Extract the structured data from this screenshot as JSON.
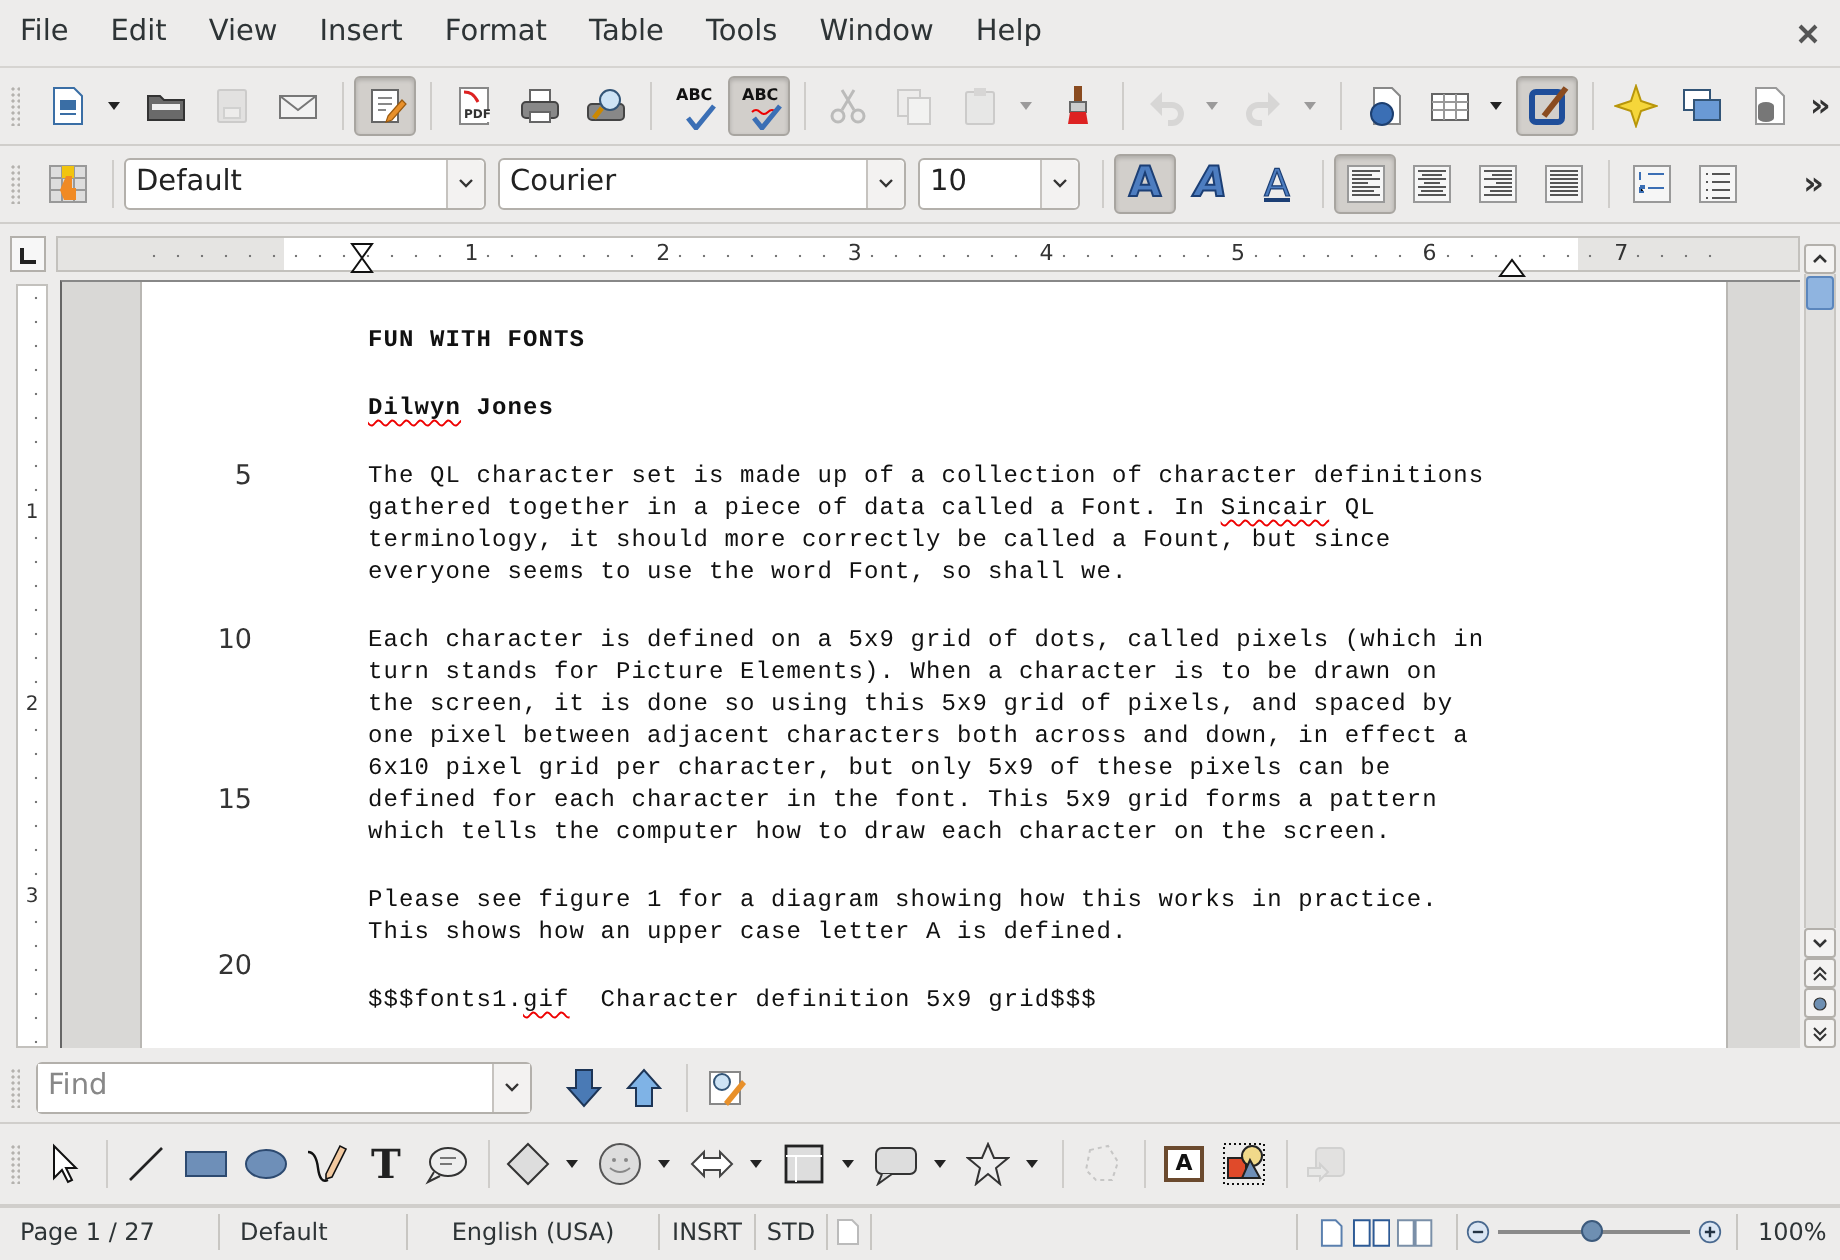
{
  "menu": [
    {
      "label": "File"
    },
    {
      "label": "Edit"
    },
    {
      "label": "View"
    },
    {
      "label": "Insert"
    },
    {
      "label": "Format"
    },
    {
      "label": "Table"
    },
    {
      "label": "Tools"
    },
    {
      "label": "Window"
    },
    {
      "label": "Help"
    }
  ],
  "standard_toolbar": {
    "items": [
      {
        "kind": "tool",
        "pressed": false,
        "disabled": false
      },
      {
        "kind": "dropdown",
        "disabled": false
      },
      {
        "kind": "tool",
        "pressed": false,
        "disabled": false
      },
      {
        "kind": "tool",
        "pressed": false,
        "disabled": true
      },
      {
        "kind": "tool",
        "pressed": false,
        "disabled": false
      },
      {
        "kind": "separator"
      },
      {
        "kind": "tool",
        "pressed": true,
        "disabled": false
      },
      {
        "kind": "separator"
      },
      {
        "kind": "tool",
        "pressed": false,
        "disabled": false,
        "glyph": "PDF"
      },
      {
        "kind": "tool",
        "pressed": false,
        "disabled": false
      },
      {
        "kind": "tool",
        "pressed": false,
        "disabled": false
      },
      {
        "kind": "separator"
      },
      {
        "kind": "tool",
        "pressed": false,
        "disabled": false,
        "glyph": "ABC"
      },
      {
        "kind": "tool",
        "pressed": true,
        "disabled": false,
        "glyph": "ABC"
      },
      {
        "kind": "separator"
      },
      {
        "kind": "tool",
        "pressed": false,
        "disabled": true
      },
      {
        "kind": "tool",
        "pressed": false,
        "disabled": true
      },
      {
        "kind": "tool",
        "pressed": false,
        "disabled": true
      },
      {
        "kind": "dropdown",
        "disabled": true
      },
      {
        "kind": "tool",
        "pressed": false,
        "disabled": false
      },
      {
        "kind": "separator"
      },
      {
        "kind": "tool",
        "pressed": false,
        "disabled": true
      },
      {
        "kind": "dropdown",
        "disabled": true
      },
      {
        "kind": "tool",
        "pressed": false,
        "disabled": true
      },
      {
        "kind": "dropdown",
        "disabled": true
      },
      {
        "kind": "separator"
      },
      {
        "kind": "tool",
        "pressed": false,
        "disabled": false
      },
      {
        "kind": "tool",
        "pressed": false,
        "disabled": false
      },
      {
        "kind": "dropdown",
        "disabled": false
      },
      {
        "kind": "tool",
        "pressed": true,
        "disabled": false
      },
      {
        "kind": "separator"
      },
      {
        "kind": "tool",
        "pressed": false,
        "disabled": false
      },
      {
        "kind": "tool",
        "pressed": false,
        "disabled": false
      },
      {
        "kind": "tool",
        "pressed": false,
        "disabled": false
      },
      {
        "kind": "overflow",
        "text": "»"
      }
    ]
  },
  "formatting_toolbar": {
    "items": [
      {
        "kind": "tool",
        "pressed": false,
        "disabled": false
      },
      {
        "kind": "separator"
      },
      {
        "kind": "combo",
        "value": "Default"
      },
      {
        "kind": "combo",
        "value": "Courier"
      },
      {
        "kind": "combo",
        "value": "10"
      },
      {
        "kind": "separator"
      },
      {
        "kind": "tool",
        "pressed": true,
        "disabled": false,
        "glyph": "A"
      },
      {
        "kind": "tool",
        "pressed": false,
        "disabled": false,
        "glyph": "A"
      },
      {
        "kind": "tool",
        "pressed": false,
        "disabled": false,
        "glyph": "A"
      },
      {
        "kind": "separator"
      },
      {
        "kind": "tool",
        "pressed": true,
        "disabled": false
      },
      {
        "kind": "tool",
        "pressed": false,
        "disabled": false
      },
      {
        "kind": "tool",
        "pressed": false,
        "disabled": false
      },
      {
        "kind": "tool",
        "pressed": false,
        "disabled": false
      },
      {
        "kind": "separator"
      },
      {
        "kind": "tool",
        "pressed": false,
        "disabled": false
      },
      {
        "kind": "tool",
        "pressed": false,
        "disabled": false
      },
      {
        "kind": "overflow",
        "text": "»"
      }
    ]
  },
  "ruler": {
    "labels": [
      "1",
      "2",
      "3",
      "4",
      "5",
      "6",
      "7"
    ]
  },
  "vertical_ruler": {
    "labels": [
      "1",
      "2",
      "3"
    ]
  },
  "document": {
    "lines": [
      {
        "kind": "text",
        "bold": true,
        "text": "FUN WITH FONTS"
      },
      {
        "kind": "blank"
      },
      {
        "kind": "text",
        "bold": true,
        "spans": [
          {
            "text": "Dilwyn",
            "misspelled": true
          },
          {
            "text": " Jones",
            "misspelled": false
          }
        ]
      },
      {
        "kind": "blank"
      },
      {
        "kind": "text",
        "number": "5",
        "text": "The QL character set is made up of a collection of character definitions"
      },
      {
        "kind": "text",
        "spans": [
          {
            "text": "gathered together in a piece of data called a Font. In ",
            "misspelled": false
          },
          {
            "text": "Sincair",
            "misspelled": true
          },
          {
            "text": " QL",
            "misspelled": false
          }
        ]
      },
      {
        "kind": "text",
        "text": "terminology, it should more correctly be called a Fount, but since"
      },
      {
        "kind": "text",
        "text": "everyone seems to use the word Font, so shall we."
      },
      {
        "kind": "blank"
      },
      {
        "kind": "text",
        "number": "10",
        "text": "Each character is defined on a 5x9 grid of dots, called pixels (which in"
      },
      {
        "kind": "text",
        "text": "turn stands for Picture Elements). When a character is to be drawn on"
      },
      {
        "kind": "text",
        "text": "the screen, it is done so using this 5x9 grid of pixels, and spaced by"
      },
      {
        "kind": "text",
        "text": "one pixel between adjacent characters both across and down, in effect a"
      },
      {
        "kind": "text",
        "text": "6x10 pixel grid per character, but only 5x9 of these pixels can be"
      },
      {
        "kind": "text",
        "number": "15",
        "text": "defined for each character in the font. This 5x9 grid forms a pattern"
      },
      {
        "kind": "text",
        "text": "which tells the computer how to draw each character on the screen."
      },
      {
        "kind": "blank"
      },
      {
        "kind": "text",
        "text": "Please see figure 1 for a diagram showing how this works in practice."
      },
      {
        "kind": "text",
        "text": "This shows how an upper case letter A is defined."
      },
      {
        "kind": "blank",
        "number": "20"
      },
      {
        "kind": "text",
        "spans": [
          {
            "text": "$$$fonts1.",
            "misspelled": false
          },
          {
            "text": "gif",
            "misspelled": true
          },
          {
            "text": "  Character definition 5x9 grid$$$",
            "misspelled": false
          }
        ]
      }
    ]
  },
  "find_bar": {
    "placeholder": "Find",
    "items": [
      {
        "kind": "tool",
        "pressed": false,
        "disabled": false
      },
      {
        "kind": "tool",
        "pressed": false,
        "disabled": false
      },
      {
        "kind": "separator"
      },
      {
        "kind": "tool",
        "pressed": false,
        "disabled": false
      }
    ]
  },
  "drawing_toolbar": {
    "items": [
      {
        "kind": "tool",
        "pressed": false,
        "disabled": false
      },
      {
        "kind": "separator"
      },
      {
        "kind": "tool",
        "pressed": false,
        "disabled": false
      },
      {
        "kind": "tool",
        "pressed": false,
        "disabled": false
      },
      {
        "kind": "tool",
        "pressed": false,
        "disabled": false
      },
      {
        "kind": "tool",
        "pressed": false,
        "disabled": false
      },
      {
        "kind": "tool",
        "pressed": false,
        "disabled": false,
        "glyph": "T"
      },
      {
        "kind": "tool",
        "pressed": false,
        "disabled": false
      },
      {
        "kind": "separator"
      },
      {
        "kind": "tool",
        "pressed": false,
        "disabled": false
      },
      {
        "kind": "dropdown",
        "disabled": false
      },
      {
        "kind": "tool",
        "pressed": false,
        "disabled": false
      },
      {
        "kind": "dropdown",
        "disabled": false
      },
      {
        "kind": "tool",
        "pressed": false,
        "disabled": false
      },
      {
        "kind": "dropdown",
        "disabled": false
      },
      {
        "kind": "tool",
        "pressed": false,
        "disabled": false
      },
      {
        "kind": "dropdown",
        "disabled": false
      },
      {
        "kind": "tool",
        "pressed": false,
        "disabled": false
      },
      {
        "kind": "dropdown",
        "disabled": false
      },
      {
        "kind": "tool",
        "pressed": false,
        "disabled": false
      },
      {
        "kind": "dropdown",
        "disabled": false
      },
      {
        "kind": "separator"
      },
      {
        "kind": "tool",
        "pressed": false,
        "disabled": true
      },
      {
        "kind": "separator"
      },
      {
        "kind": "tool",
        "pressed": false,
        "disabled": false,
        "glyph": "A"
      },
      {
        "kind": "tool",
        "pressed": false,
        "disabled": false
      },
      {
        "kind": "separator"
      },
      {
        "kind": "tool",
        "pressed": false,
        "disabled": true
      }
    ]
  },
  "status_bar": {
    "page": "Page 1 / 27",
    "page_style": "Default",
    "language": "English (USA)",
    "insert_mode": "INSRT",
    "selection_mode": "STD",
    "zoom": {
      "level": 0.49
    },
    "zoom_text": "100%"
  }
}
